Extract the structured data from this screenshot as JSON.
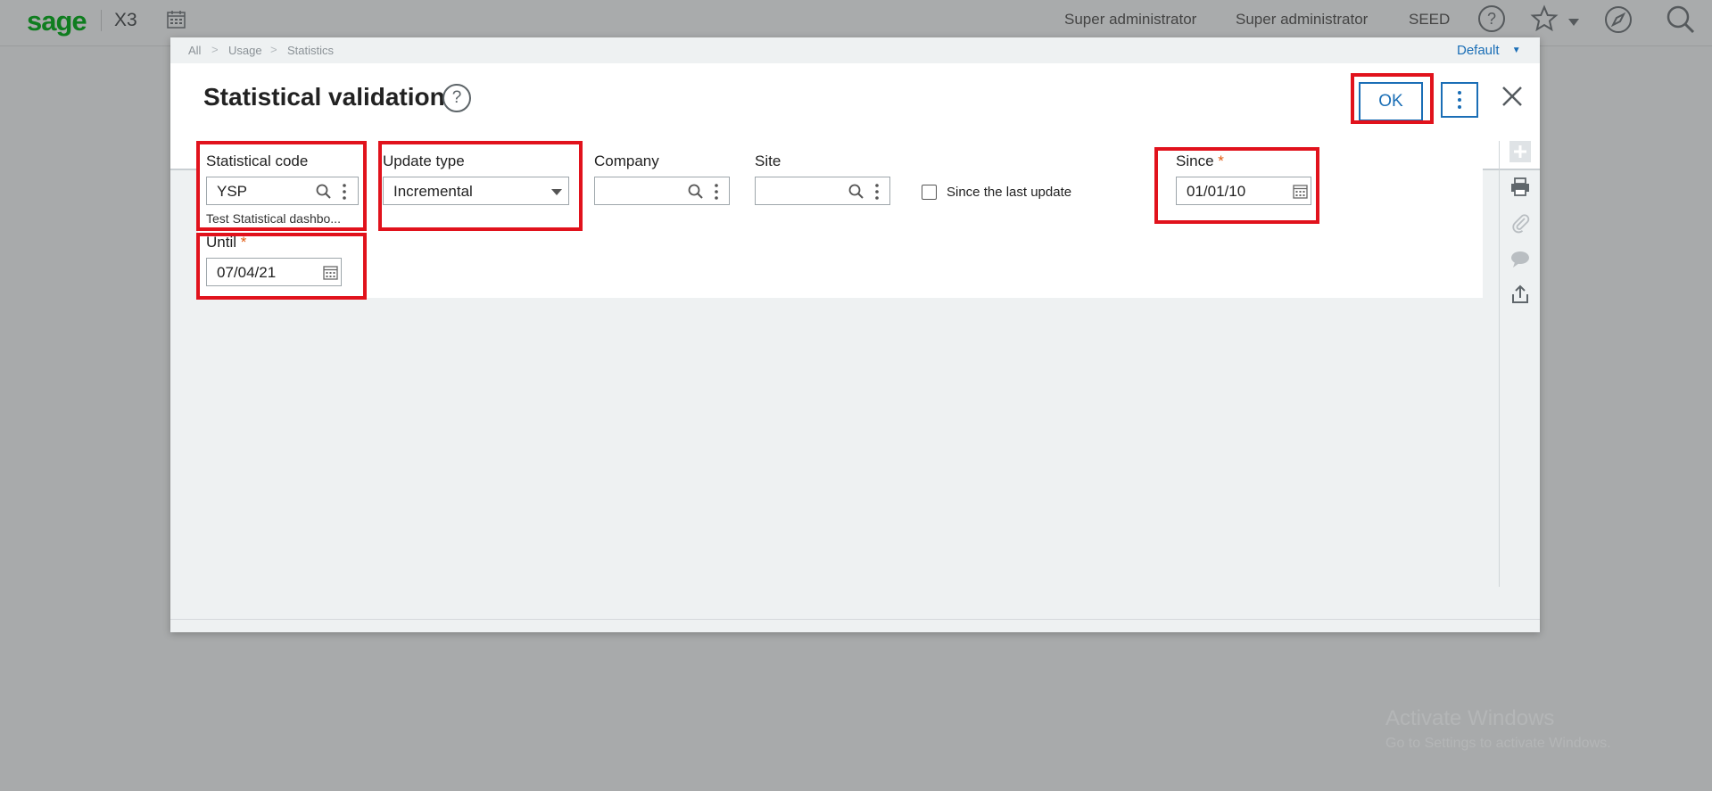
{
  "app": {
    "logo": "sage",
    "product": "X3",
    "users": [
      "Super administrator",
      "Super administrator"
    ],
    "folder": "SEED"
  },
  "breadcrumb": [
    "All",
    "Usage",
    "Statistics"
  ],
  "view_selector": "Default",
  "dialog": {
    "title": "Statistical validation",
    "help_glyph": "?",
    "ok_label": "OK"
  },
  "form": {
    "statistical_code": {
      "label": "Statistical code",
      "value": "YSP",
      "description": "Test Statistical dashbo..."
    },
    "update_type": {
      "label": "Update type",
      "value": "Incremental"
    },
    "company": {
      "label": "Company",
      "value": ""
    },
    "site": {
      "label": "Site",
      "value": ""
    },
    "since_last_update": {
      "label": "Since the last update",
      "checked": false
    },
    "since": {
      "label": "Since",
      "required_mark": "*",
      "value": "01/01/10"
    },
    "until": {
      "label": "Until",
      "required_mark": "*",
      "value": "07/04/21"
    }
  },
  "watermark": {
    "line1": "Activate Windows",
    "line2": "Go to Settings to activate Windows."
  },
  "colors": {
    "accent": "#1a6eb6",
    "highlight": "#e1121c",
    "required": "#e25c12",
    "brand": "#0f7d1f"
  }
}
